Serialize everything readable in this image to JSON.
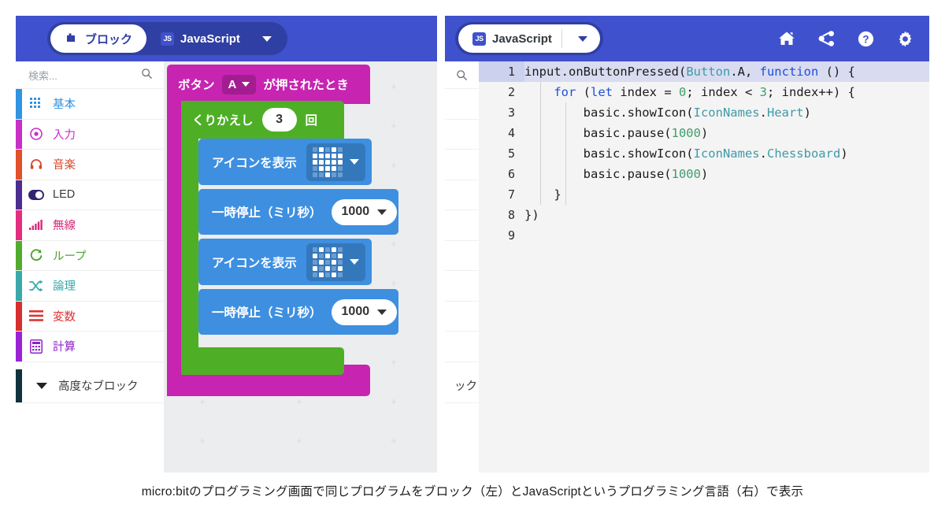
{
  "left_panel": {
    "tabs": [
      {
        "label": "ブロック",
        "icon": "blocks-icon",
        "active": true
      },
      {
        "label": "JavaScript",
        "icon": "js-icon",
        "active": false
      }
    ],
    "dropdown_icon": "chevron-down-icon",
    "search": {
      "placeholder": "検索...",
      "icon": "search-icon"
    },
    "categories": [
      {
        "label": "基本",
        "icon": "grid-icon",
        "bar_color": "#3094e0",
        "text_color": "#3094e0"
      },
      {
        "label": "入力",
        "icon": "target-icon",
        "bar_color": "#c72fc7",
        "text_color": "#c72fc7"
      },
      {
        "label": "音楽",
        "icon": "headphone-icon",
        "bar_color": "#e2502c",
        "text_color": "#d7492a"
      },
      {
        "label": "LED",
        "icon": "toggle-icon",
        "bar_color": "#4b2d8f",
        "text_color": "#3b3b3b"
      },
      {
        "label": "無線",
        "icon": "signal-icon",
        "bar_color": "#e32d80",
        "text_color": "#d92a78"
      },
      {
        "label": "ループ",
        "icon": "refresh-icon",
        "bar_color": "#52ab2e",
        "text_color": "#4ea22c"
      },
      {
        "label": "論理",
        "icon": "shuffle-icon",
        "bar_color": "#3aa8a8",
        "text_color": "#3aa8a8"
      },
      {
        "label": "変数",
        "icon": "lines-icon",
        "bar_color": "#d72f2f",
        "text_color": "#d33"
      },
      {
        "label": "計算",
        "icon": "calculator-icon",
        "bar_color": "#9b23d6",
        "text_color": "#8f22c9"
      }
    ],
    "advanced": {
      "label": "高度なブロック",
      "icon": "chevron-down-icon",
      "bar_color": "#10323c"
    },
    "blocks": {
      "event": {
        "prefix": "ボタン",
        "dropdown_value": "A",
        "suffix": "が押されたとき",
        "color": "#c724b1"
      },
      "loop": {
        "prefix": "くりかえし",
        "count": "3",
        "suffix": "回",
        "color": "#4eaf26"
      },
      "statements": [
        {
          "label": "アイコンを表示",
          "kind": "icon-matrix",
          "icon_name": "heart",
          "pattern": [
            "01010",
            "11111",
            "11111",
            "01110",
            "00100"
          ],
          "color": "#3e8fe0"
        },
        {
          "label": "一時停止（ミリ秒）",
          "kind": "number",
          "value": "1000",
          "color": "#3e8fe0"
        },
        {
          "label": "アイコンを表示",
          "kind": "icon-matrix",
          "icon_name": "chessboard",
          "pattern": [
            "01010",
            "10101",
            "01010",
            "10101",
            "01010"
          ],
          "color": "#3e8fe0"
        },
        {
          "label": "一時停止（ミリ秒）",
          "kind": "number",
          "value": "1000",
          "color": "#3e8fe0"
        }
      ]
    }
  },
  "right_panel": {
    "tab": {
      "label": "JavaScript",
      "icon": "js-icon"
    },
    "dropdown_icon": "chevron-down-icon",
    "toolbar_icons": [
      {
        "name": "home-icon",
        "glyph": "home"
      },
      {
        "name": "share-icon",
        "glyph": "share"
      },
      {
        "name": "help-icon",
        "glyph": "question"
      },
      {
        "name": "settings-icon",
        "glyph": "gear"
      }
    ],
    "toolbox": {
      "search_icon": "search-icon",
      "advanced_label_partial": "ック"
    },
    "editor": {
      "current_line": 1,
      "lines": [
        {
          "n": "1",
          "tokens": [
            {
              "t": "input.onButtonPressed(",
              "c": "plain"
            },
            {
              "t": "Button",
              "c": "type"
            },
            {
              "t": ".A, ",
              "c": "plain"
            },
            {
              "t": "function",
              "c": "kw"
            },
            {
              "t": " () {",
              "c": "plain"
            }
          ]
        },
        {
          "n": "2",
          "tokens": [
            {
              "t": "    ",
              "c": "plain"
            },
            {
              "t": "for",
              "c": "kw"
            },
            {
              "t": " (",
              "c": "plain"
            },
            {
              "t": "let",
              "c": "kw"
            },
            {
              "t": " index = ",
              "c": "plain"
            },
            {
              "t": "0",
              "c": "num"
            },
            {
              "t": "; index < ",
              "c": "plain"
            },
            {
              "t": "3",
              "c": "num"
            },
            {
              "t": "; index++) {",
              "c": "plain"
            }
          ]
        },
        {
          "n": "3",
          "tokens": [
            {
              "t": "        basic.showIcon(",
              "c": "plain"
            },
            {
              "t": "IconNames",
              "c": "type"
            },
            {
              "t": ".",
              "c": "plain"
            },
            {
              "t": "Heart",
              "c": "type"
            },
            {
              "t": ")",
              "c": "plain"
            }
          ]
        },
        {
          "n": "4",
          "tokens": [
            {
              "t": "        basic.pause(",
              "c": "plain"
            },
            {
              "t": "1000",
              "c": "num"
            },
            {
              "t": ")",
              "c": "plain"
            }
          ]
        },
        {
          "n": "5",
          "tokens": [
            {
              "t": "        basic.showIcon(",
              "c": "plain"
            },
            {
              "t": "IconNames",
              "c": "type"
            },
            {
              "t": ".",
              "c": "plain"
            },
            {
              "t": "Chessboard",
              "c": "type"
            },
            {
              "t": ")",
              "c": "plain"
            }
          ]
        },
        {
          "n": "6",
          "tokens": [
            {
              "t": "        basic.pause(",
              "c": "plain"
            },
            {
              "t": "1000",
              "c": "num"
            },
            {
              "t": ")",
              "c": "plain"
            }
          ]
        },
        {
          "n": "7",
          "tokens": [
            {
              "t": "    }",
              "c": "plain"
            }
          ]
        },
        {
          "n": "8",
          "tokens": [
            {
              "t": "})",
              "c": "plain"
            }
          ]
        },
        {
          "n": "9",
          "tokens": [
            {
              "t": "",
              "c": "plain"
            }
          ]
        }
      ]
    }
  },
  "caption": {
    "text": "micro:bitのプログラミング画面で同じプログラムをブロック（左）とJavaScriptというプログラミング言語（右）で表示"
  },
  "colors": {
    "topbar": "#3f51cc",
    "pill": "#2f3fa3",
    "canvas": "#ebedee",
    "event_block": "#c724b1",
    "loop_block": "#4eaf26",
    "basic_block": "#3e8fe0",
    "editor_bg": "#f4f4f4",
    "current_line": "#d9dcf0"
  }
}
